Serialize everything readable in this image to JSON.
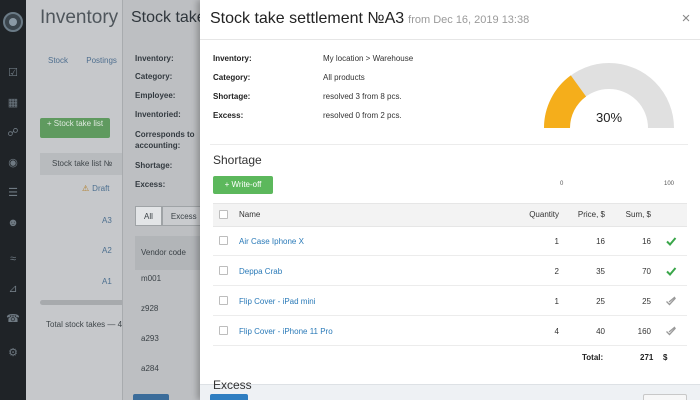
{
  "background": {
    "page_title": "Inventory",
    "tabs": [
      "Stock",
      "Postings"
    ],
    "add_button": "+ Stock take list",
    "list_header": "Stock take list №",
    "draft_label": "Draft",
    "rows": [
      "A3",
      "A2",
      "A1"
    ],
    "total": "Total stock takes — 4"
  },
  "background2": {
    "title": "Stock take",
    "labels": [
      "Inventory:",
      "Category:",
      "Employee:",
      "Inventoried:",
      "Corresponds to accounting:",
      "Shortage:",
      "Excess:"
    ],
    "tabs": [
      "All",
      "Excess"
    ],
    "table_header": "Vendor code",
    "codes": [
      "m001",
      "z928",
      "a293",
      "a284"
    ]
  },
  "modal": {
    "title": "Stock take settlement №A3",
    "subtitle": "from Dec 16, 2019 13:38",
    "info": [
      {
        "label": "Inventory:",
        "value": "My location > Warehouse"
      },
      {
        "label": "Category:",
        "value": "All products"
      },
      {
        "label": "Shortage:",
        "value": "resolved 3 from 8 pcs."
      },
      {
        "label": "Excess:",
        "value": "resolved 0 from 2 pcs."
      }
    ],
    "gauge": {
      "percent_label": "30%",
      "fraction": 0.3,
      "min_label": "0",
      "max_label": "100",
      "fill_color": "#f5ae1b",
      "track_color": "#e0e0e0"
    },
    "shortage_title": "Shortage",
    "writeoff_label": "+ Write-off",
    "columns": {
      "name": "Name",
      "quantity": "Quantity",
      "price": "Price, $",
      "sum": "Sum, $"
    },
    "rows": [
      {
        "name": "Air Case Iphone X",
        "quantity": "1",
        "price": "16",
        "sum": "16",
        "status": "check-green-icon"
      },
      {
        "name": "Deppa Crab",
        "quantity": "2",
        "price": "35",
        "sum": "70",
        "status": "check-green-icon"
      },
      {
        "name": "Flip Cover - iPad mini",
        "quantity": "1",
        "price": "25",
        "sum": "25",
        "status": "check-grey-icon"
      },
      {
        "name": "Flip Cover - iPhone 11 Pro",
        "quantity": "4",
        "price": "40",
        "sum": "160",
        "status": "check-grey-icon"
      }
    ],
    "total_label": "Total:",
    "total_value": "271",
    "total_currency": "$",
    "excess_title": "Excess"
  }
}
